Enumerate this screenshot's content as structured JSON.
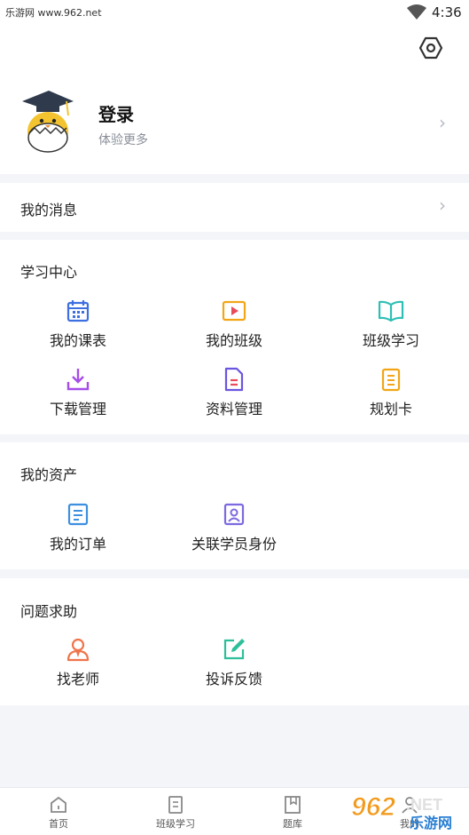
{
  "status": {
    "watermark": "乐游网 www.962.net",
    "time": "4:36"
  },
  "profile": {
    "login": "登录",
    "subtitle": "体验更多"
  },
  "messages": {
    "label": "我的消息"
  },
  "study": {
    "title": "学习中心",
    "items": [
      {
        "label": "我的课表",
        "icon": "calendar-icon"
      },
      {
        "label": "我的班级",
        "icon": "video-class-icon"
      },
      {
        "label": "班级学习",
        "icon": "book-open-icon"
      },
      {
        "label": "下载管理",
        "icon": "download-icon"
      },
      {
        "label": "资料管理",
        "icon": "document-icon"
      },
      {
        "label": "规划卡",
        "icon": "plan-card-icon"
      }
    ]
  },
  "assets": {
    "title": "我的资产",
    "items": [
      {
        "label": "我的订单",
        "icon": "order-icon"
      },
      {
        "label": "关联学员身份",
        "icon": "student-id-icon"
      }
    ]
  },
  "help": {
    "title": "问题求助",
    "items": [
      {
        "label": "找老师",
        "icon": "teacher-icon"
      },
      {
        "label": "投诉反馈",
        "icon": "feedback-edit-icon"
      }
    ]
  },
  "tabs": [
    {
      "label": "首页",
      "icon": "home-icon"
    },
    {
      "label": "班级学习",
      "icon": "class-icon"
    },
    {
      "label": "题库",
      "icon": "bookmark-icon"
    },
    {
      "label": "我的",
      "icon": "profile-icon"
    }
  ],
  "watermark_logo": {
    "number": "962",
    "suffix": ".NET",
    "text": "乐游网"
  }
}
